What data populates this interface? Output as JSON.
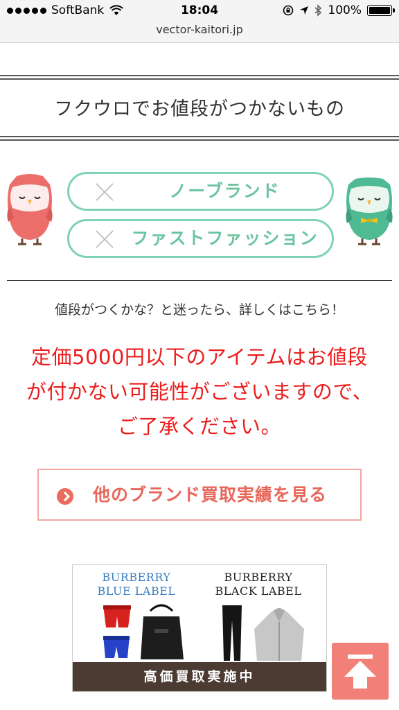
{
  "status_bar": {
    "carrier": "SoftBank",
    "time": "18:04",
    "battery": "100%"
  },
  "browser": {
    "url": "vector-kaitori.jp"
  },
  "section": {
    "heading": "フクウロでお値段がつかないもの"
  },
  "no_price_items": [
    {
      "label": "ノーブランド"
    },
    {
      "label": "ファストファッション"
    }
  ],
  "question_text": "値段がつくかな？と迷ったら、詳しくはこちら！",
  "notice_lines": [
    "定価5000円以下のアイテムはお値段",
    "が付かない可能性がございますので、",
    "ご了承ください。"
  ],
  "cta": {
    "label": "他のブランド買取実績を見る"
  },
  "banner": {
    "brand_left_line1": "BURBERRY",
    "brand_left_line2": "BLUE LABEL",
    "brand_right_line1": "BURBERRY",
    "brand_right_line2": "BLACK LABEL",
    "footer": "高価買取実施中"
  },
  "colors": {
    "accent_green": "#7ed3b2",
    "notice_red": "#ec1c1c",
    "cta_red": "#e8665a",
    "to_top": "#f08078"
  },
  "icons": {
    "wifi": "wifi-icon",
    "lock_rotation": "rotation-lock-icon",
    "location": "location-arrow-icon",
    "bluetooth": "bluetooth-icon",
    "battery": "battery-icon",
    "owl_left": "pink-owl-icon",
    "owl_right": "green-owl-icon",
    "cross": "cross-icon",
    "chevron": "chevron-right-icon",
    "back_to_top": "arrow-up-icon"
  }
}
